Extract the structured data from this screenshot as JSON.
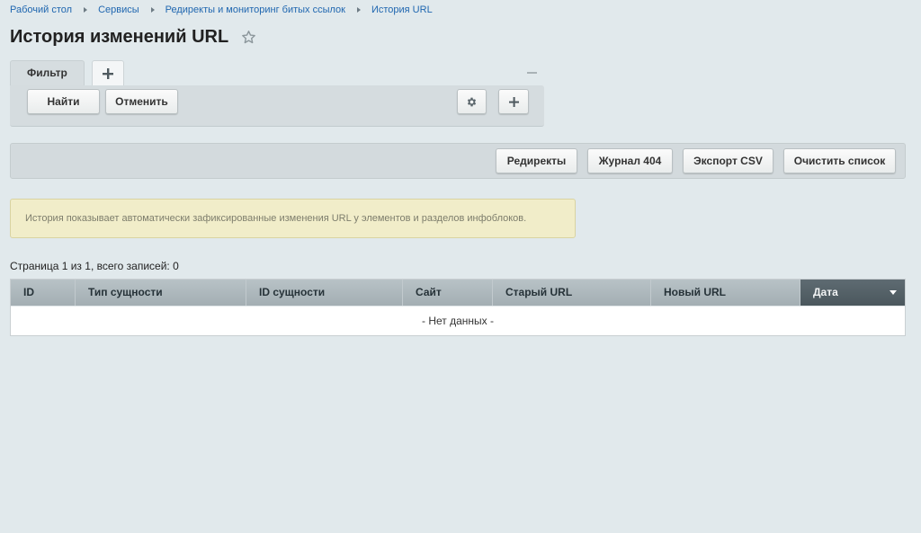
{
  "breadcrumb": [
    "Рабочий стол",
    "Сервисы",
    "Редиректы и мониторинг битых ссылок",
    "История URL"
  ],
  "page_title": "История изменений URL",
  "filter": {
    "tab_label": "Фильтр",
    "find_label": "Найти",
    "cancel_label": "Отменить"
  },
  "toolbar": {
    "redirects_label": "Редиректы",
    "journal_label": "Журнал 404",
    "export_label": "Экспорт CSV",
    "clear_label": "Очистить список"
  },
  "notice": "История показывает автоматически зафиксированные изменения URL у элементов и разделов инфоблоков.",
  "pagination": "Страница 1 из 1, всего записей: 0",
  "table": {
    "columns": [
      "ID",
      "Тип сущности",
      "ID сущности",
      "Сайт",
      "Старый URL",
      "Новый URL",
      "Дата"
    ],
    "empty_text": "- Нет данных -"
  },
  "colors": {
    "background": "#e1e9ec",
    "link": "#2067b0",
    "notice_bg": "#f1edc9",
    "sorted_header": "#55616a"
  }
}
